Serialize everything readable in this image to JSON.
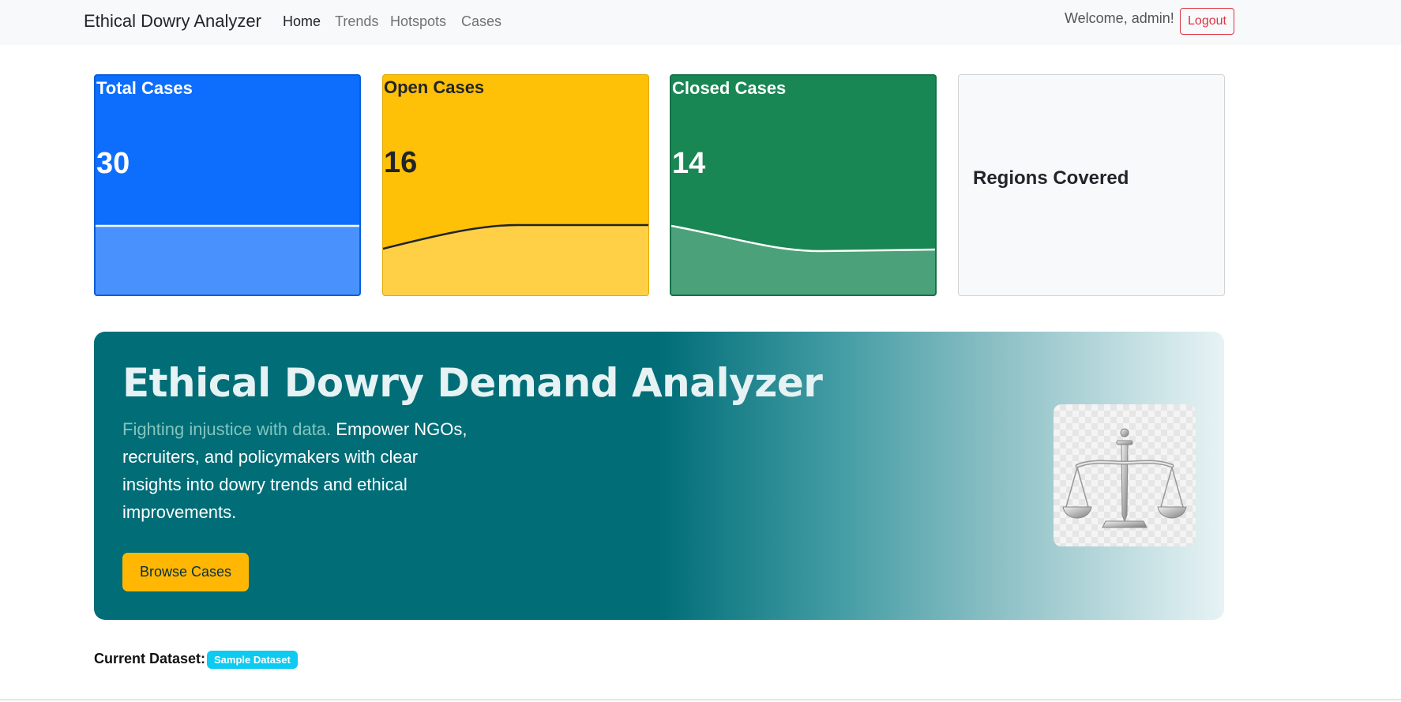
{
  "navbar": {
    "brand": "Ethical Dowry Analyzer",
    "links": [
      {
        "label": "Home",
        "active": true
      },
      {
        "label": "Trends",
        "active": false
      },
      {
        "label": "Hotspots",
        "active": false
      },
      {
        "label": "Cases",
        "active": false
      }
    ],
    "welcome": "Welcome, admin!",
    "logout_label": "Logout"
  },
  "stats": {
    "total": {
      "title": "Total Cases",
      "value": "30",
      "color": "#0d6efd"
    },
    "open": {
      "title": "Open Cases",
      "value": "16",
      "color": "#ffc107"
    },
    "closed": {
      "title": "Closed Cases",
      "value": "14",
      "color": "#198754"
    },
    "regions": {
      "title": "Regions Covered",
      "value": ""
    }
  },
  "hero": {
    "title": "Ethical Dowry Demand Analyzer",
    "tagline": "Fighting injustice with data.",
    "description": "Empower NGOs, recruiters, and policymakers with clear insights into dowry trends and ethical improvements.",
    "button_label": "Browse Cases",
    "image_icon": "scales-of-justice-icon",
    "colors": {
      "primary": "#006d77",
      "accent": "#83c5be",
      "button": "#ffb703"
    }
  },
  "dataset": {
    "label": "Current Dataset:",
    "badge": "Sample Dataset"
  }
}
